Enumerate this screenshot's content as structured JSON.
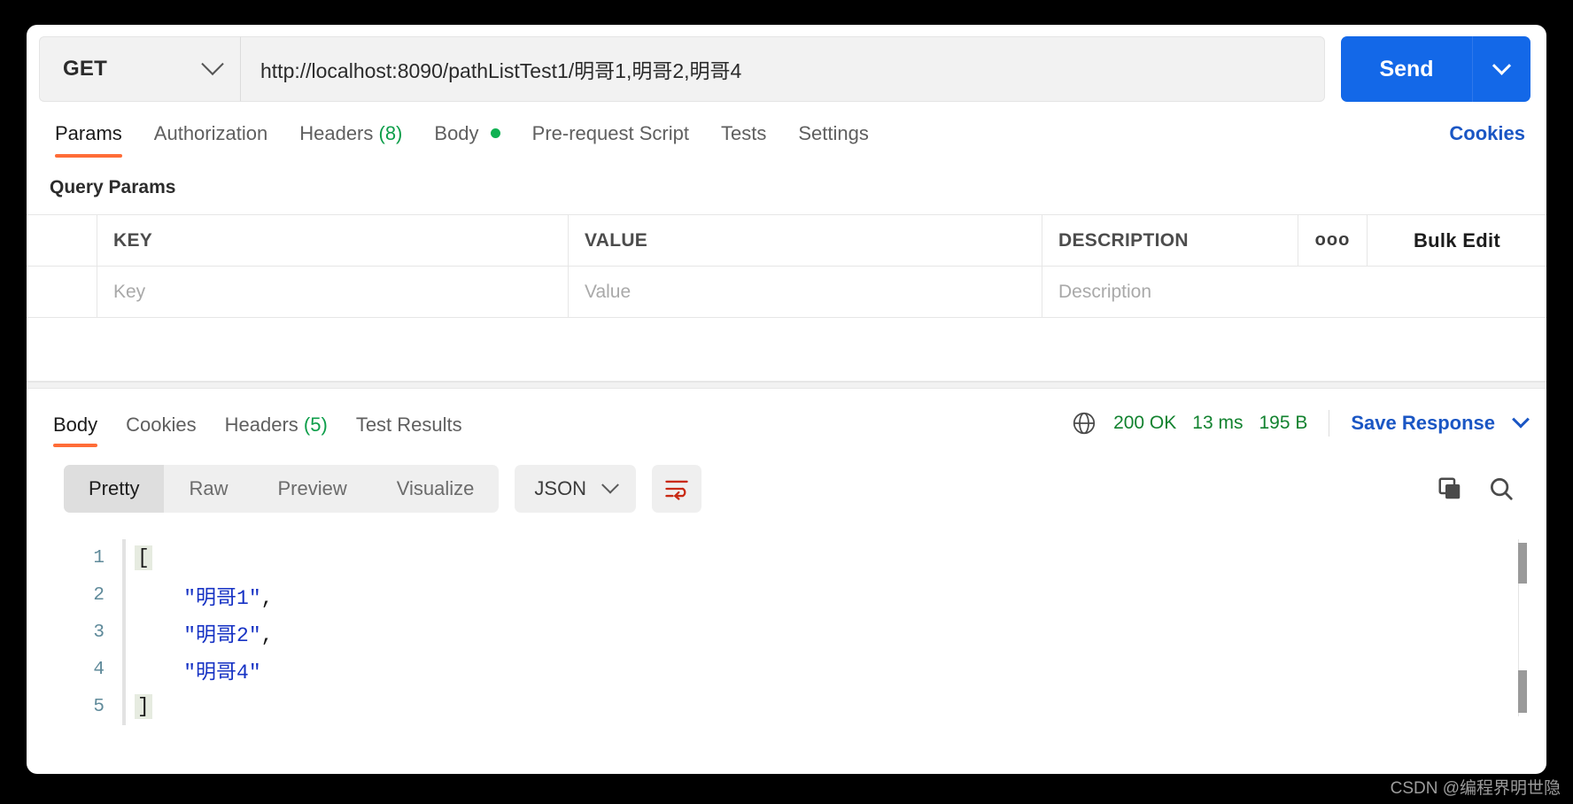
{
  "request": {
    "method": "GET",
    "url": "http://localhost:8090/pathListTest1/明哥1,明哥2,明哥4",
    "send_label": "Send",
    "tabs": [
      {
        "label": "Params",
        "count": "",
        "dot": false,
        "active": true
      },
      {
        "label": "Authorization",
        "count": "",
        "dot": false,
        "active": false
      },
      {
        "label": "Headers",
        "count": "(8)",
        "dot": false,
        "active": false
      },
      {
        "label": "Body",
        "count": "",
        "dot": true,
        "active": false
      },
      {
        "label": "Pre-request Script",
        "count": "",
        "dot": false,
        "active": false
      },
      {
        "label": "Tests",
        "count": "",
        "dot": false,
        "active": false
      },
      {
        "label": "Settings",
        "count": "",
        "dot": false,
        "active": false
      }
    ],
    "cookies_link": "Cookies"
  },
  "query_params": {
    "section_title": "Query Params",
    "columns": [
      "KEY",
      "VALUE",
      "DESCRIPTION"
    ],
    "more_glyph": "ooo",
    "bulk_edit_label": "Bulk Edit",
    "empty_row": {
      "key_placeholder": "Key",
      "value_placeholder": "Value",
      "description_placeholder": "Description"
    }
  },
  "response": {
    "tabs": [
      {
        "label": "Body",
        "count": "",
        "active": true
      },
      {
        "label": "Cookies",
        "count": "",
        "active": false
      },
      {
        "label": "Headers",
        "count": "(5)",
        "active": false
      },
      {
        "label": "Test Results",
        "count": "",
        "active": false
      }
    ],
    "status": {
      "code": "200 OK",
      "time": "13 ms",
      "size": "195 B"
    },
    "save_response_label": "Save Response",
    "view_modes": [
      {
        "label": "Pretty",
        "active": true
      },
      {
        "label": "Raw",
        "active": false
      },
      {
        "label": "Preview",
        "active": false
      },
      {
        "label": "Visualize",
        "active": false
      }
    ],
    "format": "JSON",
    "body_lines": [
      {
        "no": "1",
        "segments": [
          {
            "text": "[",
            "type": "bracket"
          }
        ]
      },
      {
        "no": "2",
        "segments": [
          {
            "text": "    \"明哥1\"",
            "type": "string"
          },
          {
            "text": ",",
            "type": "punc"
          }
        ]
      },
      {
        "no": "3",
        "segments": [
          {
            "text": "    \"明哥2\"",
            "type": "string"
          },
          {
            "text": ",",
            "type": "punc"
          }
        ]
      },
      {
        "no": "4",
        "segments": [
          {
            "text": "    \"明哥4\"",
            "type": "string"
          }
        ]
      },
      {
        "no": "5",
        "segments": [
          {
            "text": "]",
            "type": "bracket"
          }
        ]
      }
    ]
  },
  "colors": {
    "accent_orange": "#ff6c37",
    "send_blue": "#1368e8",
    "link_blue": "#1a56c4",
    "status_green": "#12822f",
    "wrap_icon_red": "#c92a14",
    "json_string_blue": "#1632c4"
  },
  "watermark": "CSDN @编程界明世隐"
}
